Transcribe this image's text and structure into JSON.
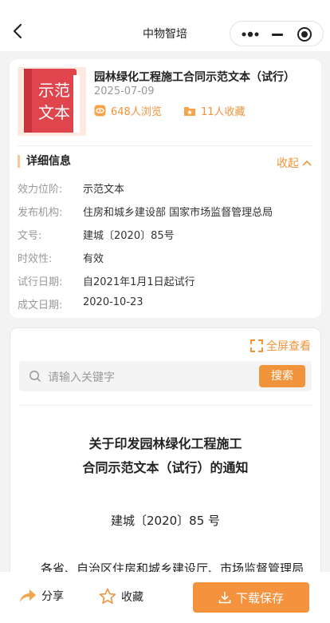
{
  "nav": {
    "title": "中物智培"
  },
  "doc": {
    "cover_line1": "示范",
    "cover_line2": "文本",
    "title": "园林绿化工程施工合同示范文本（试行）",
    "date": "2025-07-09",
    "views": "648人浏览",
    "favorites": "11人收藏"
  },
  "details": {
    "heading": "详细信息",
    "collapse_label": "收起",
    "rows": [
      {
        "k": "效力位阶:",
        "v": "示范文本"
      },
      {
        "k": "发布机构:",
        "v": "住房和城乡建设部 国家市场监督管理总局"
      },
      {
        "k": "文号:",
        "v": "建城〔2020〕85号"
      },
      {
        "k": "时效性:",
        "v": "有效"
      },
      {
        "k": "试行日期:",
        "v": "自2021年1月1日起试行"
      },
      {
        "k": "成文日期:",
        "v": "2020-10-23"
      }
    ]
  },
  "reader": {
    "fullscreen_label": "全屏查看",
    "search_placeholder": "请输入关键字",
    "search_button": "搜索",
    "notice_title_1": "关于印发园林绿化工程施工",
    "notice_title_2": "合同示范文本（试行）的通知",
    "notice_no": "建城〔2020〕85 号",
    "notice_body": "各省、自治区住房和城乡建设厅、市场监督管理局"
  },
  "bottom": {
    "share": "分享",
    "favorite": "收藏",
    "download": "下载保存"
  },
  "colors": {
    "accent": "#f0933b",
    "cover_red": "#e0444d"
  }
}
